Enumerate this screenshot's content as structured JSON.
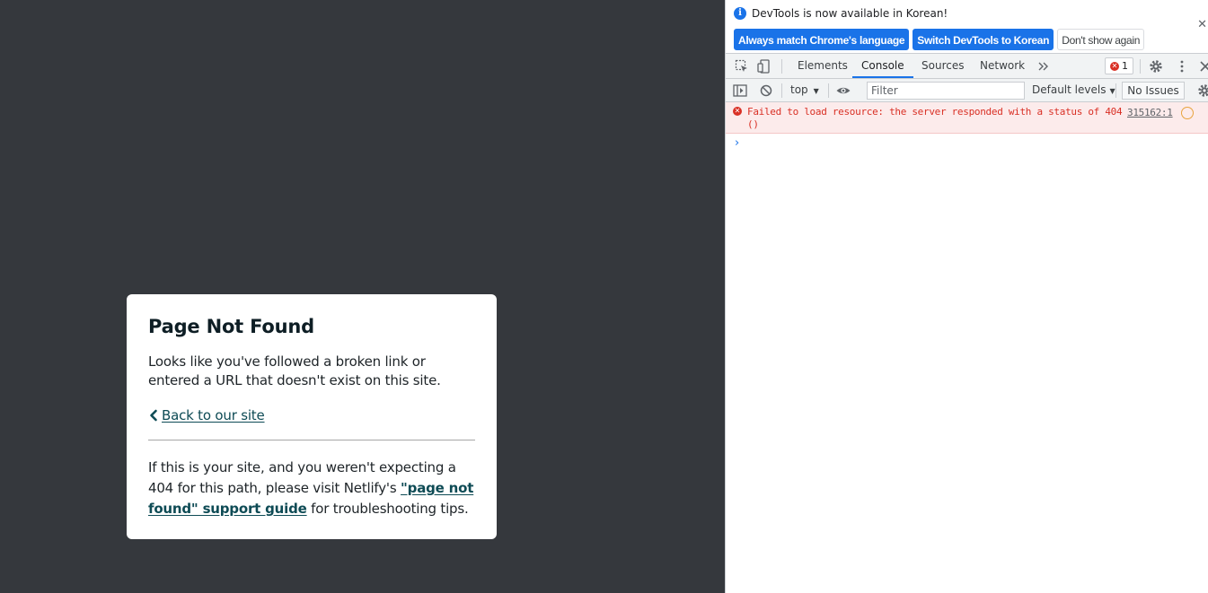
{
  "page": {
    "title": "Page Not Found",
    "message": "Looks like you've followed a broken link or entered a URL that doesn't exist on this site.",
    "back_link": "Back to our site",
    "help_prefix": "If this is your site, and you weren't expecting a 404 for this path, please visit Netlify's ",
    "help_link": "\"page not found\" support guide",
    "help_suffix": " for troubleshooting tips."
  },
  "devtools": {
    "infobar": {
      "message": "DevTools is now available in Korean!",
      "btn_match": "Always match Chrome's language",
      "btn_switch": "Switch DevTools to Korean",
      "btn_dismiss": "Don't show again"
    },
    "tabs": [
      "Elements",
      "Console",
      "Sources",
      "Network"
    ],
    "active_tab": "Console",
    "error_count": "1",
    "console": {
      "context": "top",
      "filter_placeholder": "Filter",
      "levels": "Default levels",
      "issues": "No Issues"
    },
    "messages": [
      {
        "level": "error",
        "text": "Failed to load resource: the server responded with a status of 404 ()",
        "source": "315162:1"
      }
    ]
  },
  "colors": {
    "page_bg": "#35383d",
    "link": "#0e4b55",
    "accent": "#1a73e8",
    "error": "#d93025"
  }
}
